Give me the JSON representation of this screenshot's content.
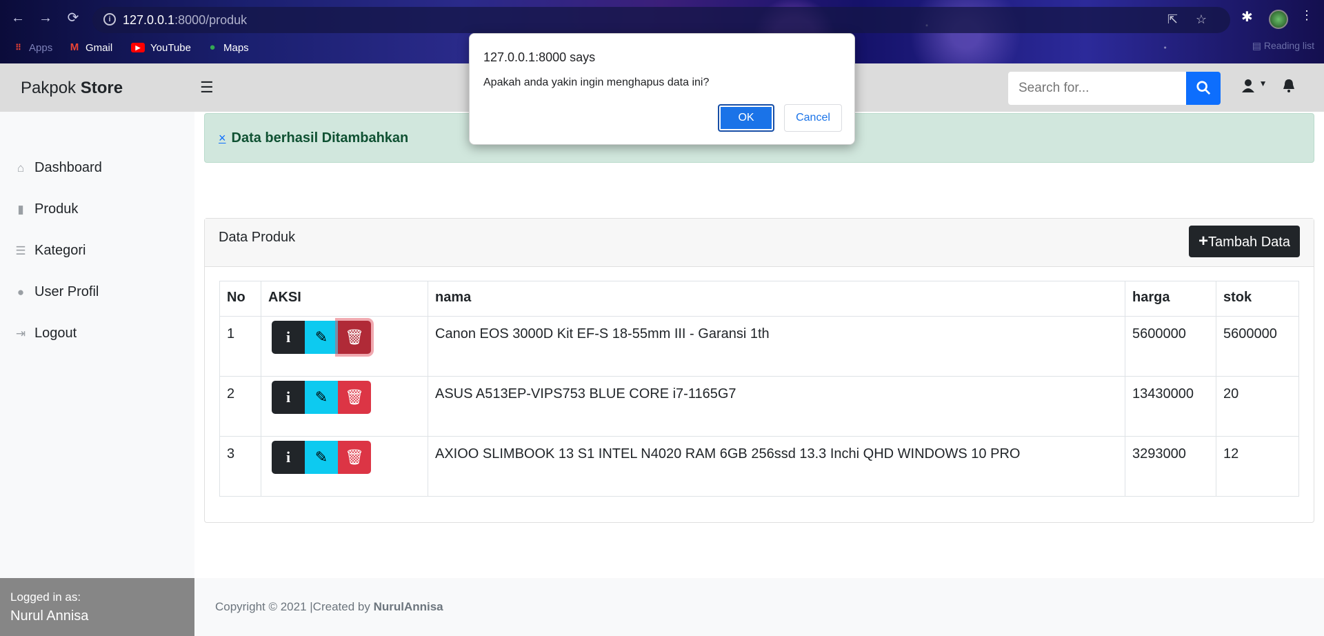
{
  "browser": {
    "url_host": "127.0.0.1",
    "url_rest": ":8000/produk",
    "bookmarks": [
      {
        "label": "Apps",
        "icon": "apps-grid-icon"
      },
      {
        "label": "Gmail",
        "icon": "gmail-icon"
      },
      {
        "label": "YouTube",
        "icon": "youtube-icon"
      },
      {
        "label": "Maps",
        "icon": "maps-icon"
      }
    ],
    "reading_list": "Reading list"
  },
  "app": {
    "brand_light": "Pakpok ",
    "brand_bold": "Store",
    "search_placeholder": "Search for..."
  },
  "sidebar": {
    "items": [
      {
        "label": "Dashboard",
        "icon": "home-icon"
      },
      {
        "label": "Produk",
        "icon": "bag-icon"
      },
      {
        "label": "Kategori",
        "icon": "list-icon"
      },
      {
        "label": "User Profil",
        "icon": "user-icon"
      },
      {
        "label": "Logout",
        "icon": "sign-out-icon"
      }
    ],
    "logged_in_label": "Logged in as:",
    "logged_in_user": "Nurul Annisa"
  },
  "alert": {
    "close": "×",
    "message": "Data berhasil Ditambahkan"
  },
  "card": {
    "title": "Data Produk",
    "add_button": "Tambah Data"
  },
  "table": {
    "headers": [
      "No",
      "AKSI",
      "nama",
      "harga",
      "stok"
    ],
    "rows": [
      {
        "no": "1",
        "nama": "Canon EOS 3000D Kit EF-S 18-55mm III - Garansi 1th",
        "harga": "5600000",
        "stok": "5600000"
      },
      {
        "no": "2",
        "nama": "ASUS A513EP-VIPS753 BLUE CORE i7-1165G7",
        "harga": "13430000",
        "stok": "20"
      },
      {
        "no": "3",
        "nama": "AXIOO SLIMBOOK 13 S1 INTEL N4020 RAM 6GB 256ssd 13.3 Inchi QHD WINDOWS 10 PRO",
        "harga": "3293000",
        "stok": "12"
      }
    ]
  },
  "footer": {
    "text": "Copyright © 2021 |Created by ",
    "author": "NurulAnnisa"
  },
  "dialog": {
    "title": "127.0.0.1:8000 says",
    "message": "Apakah anda yakin ingin menghapus data ini?",
    "ok": "OK",
    "cancel": "Cancel"
  }
}
